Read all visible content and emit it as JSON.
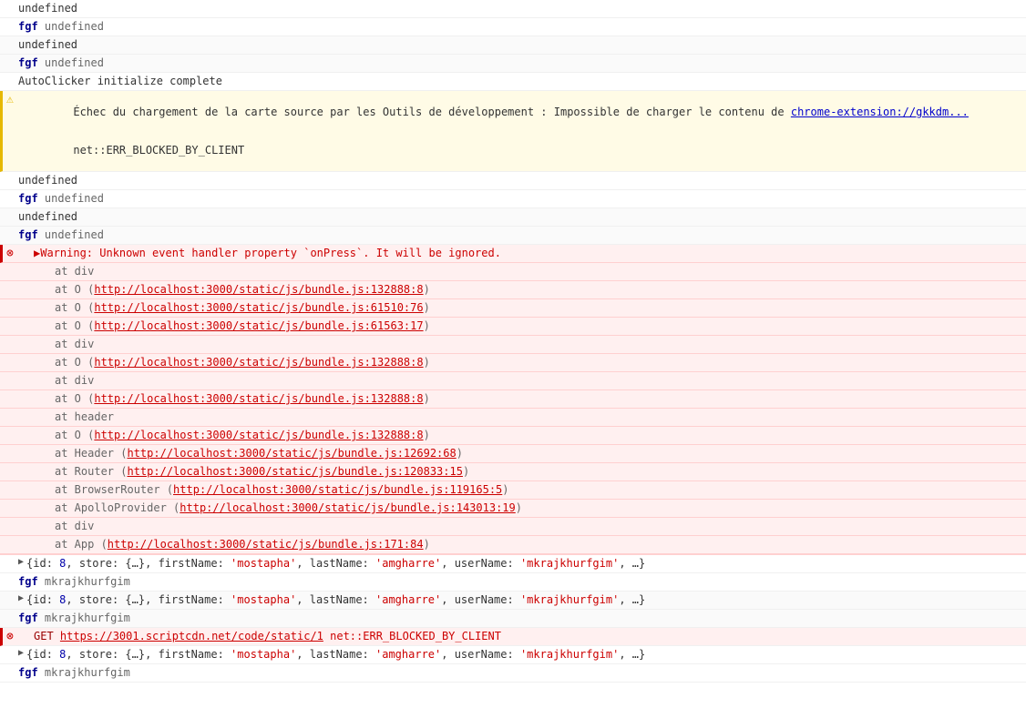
{
  "rows": [
    {
      "type": "plain",
      "text": "undefined"
    },
    {
      "type": "fgf",
      "prefix": "fgf",
      "text": "undefined"
    },
    {
      "type": "plain-alt",
      "text": "undefined"
    },
    {
      "type": "fgf-alt",
      "prefix": "fgf",
      "text": "undefined"
    },
    {
      "type": "autoclicker",
      "text": "AutoClicker initialize complete"
    },
    {
      "type": "warning-source",
      "text": "Échec du chargement de la carte source par les Outils de développement : Impossible de charger le contenu de ",
      "link": "chrome-extension://gkkdm...",
      "suffix": "\nnet::ERR_BLOCKED_BY_CLIENT"
    },
    {
      "type": "plain",
      "text": "undefined"
    },
    {
      "type": "fgf",
      "prefix": "fgf",
      "text": "undefined"
    },
    {
      "type": "plain-alt",
      "text": "undefined"
    },
    {
      "type": "fgf-alt",
      "prefix": "fgf",
      "text": "undefined"
    },
    {
      "type": "error-header",
      "text": "Warning: Unknown event handler property `onPress`. It will be ignored."
    },
    {
      "type": "error-stack",
      "lines": [
        {
          "label": "at div",
          "link": null
        },
        {
          "label": "at O ",
          "link": "http://localhost:3000/static/js/bundle.js:132888:8"
        },
        {
          "label": "at O ",
          "link": "http://localhost:3000/static/js/bundle.js:61510:76"
        },
        {
          "label": "at O ",
          "link": "http://localhost:3000/static/js/bundle.js:61563:17"
        },
        {
          "label": "at div",
          "link": null
        },
        {
          "label": "at O ",
          "link": "http://localhost:3000/static/js/bundle.js:132888:8"
        },
        {
          "label": "at div",
          "link": null
        },
        {
          "label": "at O ",
          "link": "http://localhost:3000/static/js/bundle.js:132888:8"
        },
        {
          "label": "at header",
          "link": null
        },
        {
          "label": "at O ",
          "link": "http://localhost:3000/static/js/bundle.js:132888:8"
        },
        {
          "label": "at Header ",
          "link": "http://localhost:3000/static/js/bundle.js:12692:68"
        },
        {
          "label": "at Router ",
          "link": "http://localhost:3000/static/js/bundle.js:120833:15"
        },
        {
          "label": "at BrowserRouter ",
          "link": "http://localhost:3000/static/js/bundle.js:119165:5"
        },
        {
          "label": "at ApolloProvider ",
          "link": "http://localhost:3000/static/js/bundle.js:143013:19"
        },
        {
          "label": "at div",
          "link": null
        },
        {
          "label": "at App ",
          "link": "http://localhost:3000/static/js/bundle.js:171:84"
        }
      ]
    },
    {
      "type": "obj-row",
      "text": "▶ {id: 8, store: {…}, firstName: 'mostapha', lastName: 'amgharre', userName: 'mkrajkhurfgim', …}"
    },
    {
      "type": "fgf-plain",
      "prefix": "fgf",
      "text": "mkrajkhurfgim"
    },
    {
      "type": "obj-row",
      "text": "▶ {id: 8, store: {…}, firstName: 'mostapha', lastName: 'amgharre', userName: 'mkrajkhurfgim', …}"
    },
    {
      "type": "fgf-plain",
      "prefix": "fgf",
      "text": "mkrajkhurfgim"
    },
    {
      "type": "get-error",
      "text": "GET ",
      "link": "https://3001.scriptcdn.net/code/static/1",
      "suffix": " net::ERR_BLOCKED_BY_CLIENT"
    },
    {
      "type": "obj-row",
      "text": "▶ {id: 8, store: {…}, firstName: 'mostapha', lastName: 'amgharre', userName: 'mkrajkhurfgim', …}"
    },
    {
      "type": "fgf-plain",
      "prefix": "fgf",
      "text": "mkrajkhurfgim"
    }
  ]
}
